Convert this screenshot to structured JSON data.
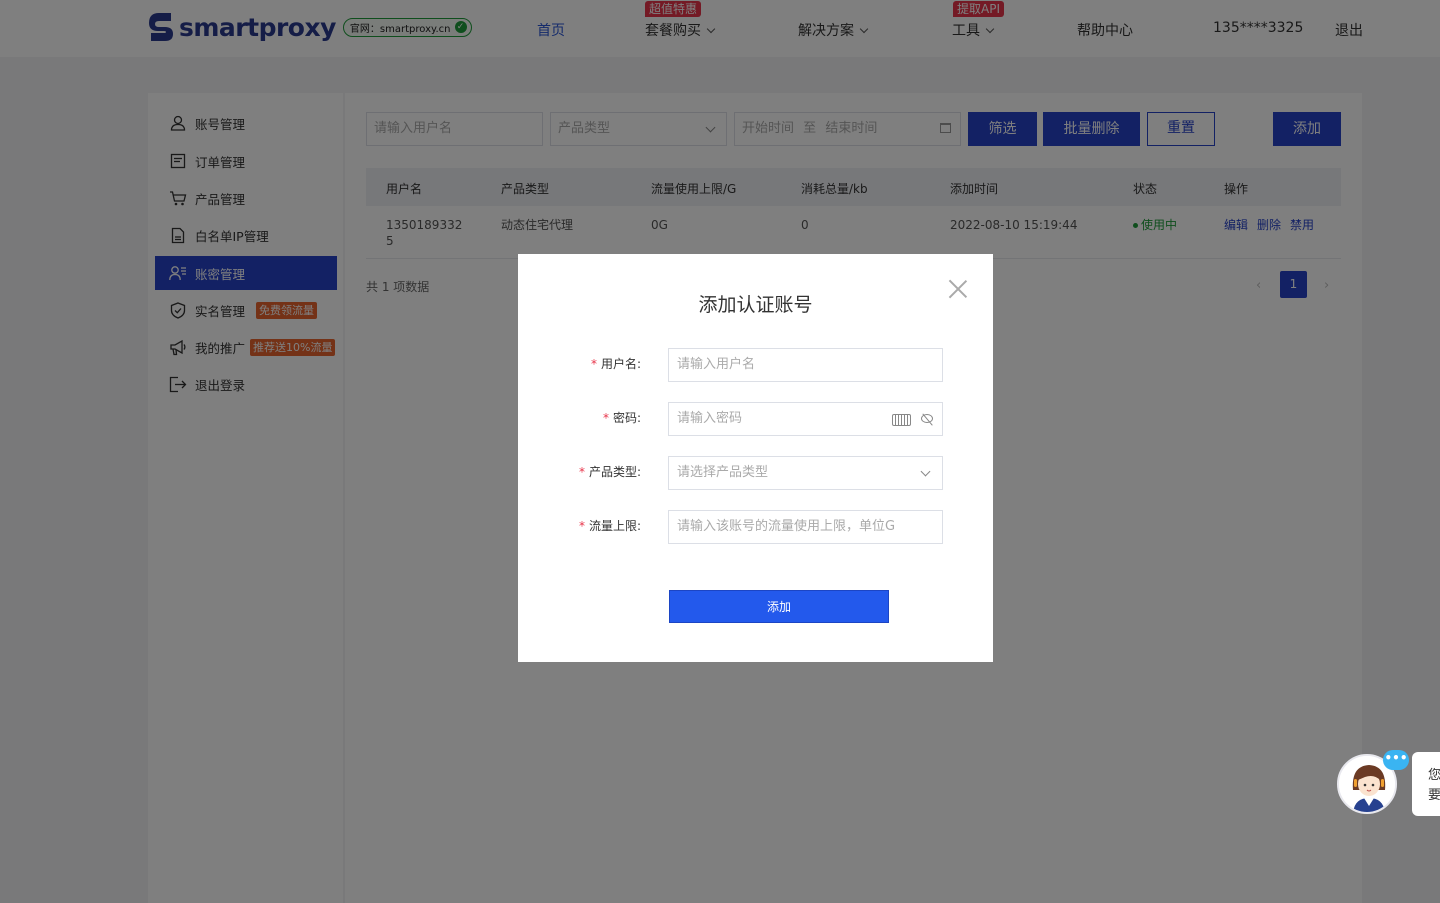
{
  "header": {
    "logo_text": "smartproxy",
    "site_badge": "官网：smartproxy.cn",
    "nav": [
      {
        "label": "首页"
      },
      {
        "label": "套餐购买",
        "tag": "超值特惠"
      },
      {
        "label": "解决方案"
      },
      {
        "label": "工具",
        "tag": "提取API"
      },
      {
        "label": "帮助中心"
      }
    ],
    "user": "135****3325",
    "logout": "退出"
  },
  "sidebar": {
    "items": [
      {
        "label": "账号管理",
        "icon": "user-icon"
      },
      {
        "label": "订单管理",
        "icon": "order-icon"
      },
      {
        "label": "产品管理",
        "icon": "cart-icon"
      },
      {
        "label": "白名单IP管理",
        "icon": "document-icon"
      },
      {
        "label": "账密管理",
        "icon": "user-list-icon",
        "active": true
      },
      {
        "label": "实名管理",
        "icon": "shield-icon",
        "badge": "免费领流量"
      },
      {
        "label": "我的推广",
        "icon": "megaphone-icon",
        "badge": "推荐送10%流量"
      },
      {
        "label": "退出登录",
        "icon": "logout-icon"
      }
    ]
  },
  "toolbar": {
    "username_placeholder": "请输入用户名",
    "product_type_placeholder": "产品类型",
    "date_start": "开始时间",
    "date_sep": "至",
    "date_end": "结束时间",
    "filter": "筛选",
    "batch_delete": "批量删除",
    "reset": "重置",
    "add": "添加"
  },
  "table": {
    "columns": [
      "用户名",
      "产品类型",
      "流量使用上限/G",
      "消耗总量/kb",
      "添加时间",
      "状态",
      "操作"
    ],
    "rows": [
      {
        "username": "13501893325",
        "username_line1": "1350189332",
        "username_line2": "5",
        "product_type": "动态住宅代理",
        "limit": "0G",
        "consumed": "0",
        "added_at": "2022-08-10 15:19:44",
        "status": "使用中",
        "actions": [
          "编辑",
          "删除",
          "禁用"
        ]
      }
    ]
  },
  "pagination": {
    "total_text": "共 1 项数据",
    "current_page": "1",
    "prev": "‹",
    "next": "›"
  },
  "modal": {
    "title": "添加认证账号",
    "fields": [
      {
        "label": "用户名:",
        "placeholder": "请输入用户名"
      },
      {
        "label": "密码:",
        "placeholder": "请输入密码"
      },
      {
        "label": "产品类型:",
        "placeholder": "请选择产品类型"
      },
      {
        "label": "流量上限:",
        "placeholder": "请输入该账号的流量使用上限，单位G"
      }
    ],
    "submit": "添加"
  },
  "chat": {
    "dots": "•••",
    "bubble_line1": "您",
    "bubble_line2": "要"
  },
  "colors": {
    "primary": "#2743c9",
    "modal_button": "#2359ec",
    "tag_red": "#e8344a",
    "badge_orange": "#e8652f",
    "status_green": "#1f9d3a"
  }
}
